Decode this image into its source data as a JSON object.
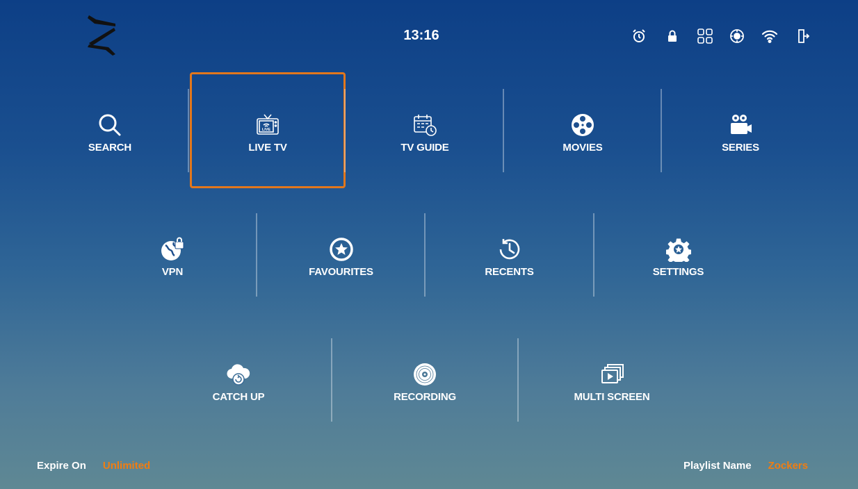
{
  "header": {
    "time": "13:16",
    "icons": [
      "alarm-icon",
      "lock-icon",
      "grid-icon",
      "sync-settings-icon",
      "wifi-icon",
      "exit-icon"
    ]
  },
  "menu": {
    "row1": [
      {
        "label": "SEARCH",
        "icon": "search-icon"
      },
      {
        "label": "LIVE TV",
        "icon": "tv-icon",
        "selected": true
      },
      {
        "label": "TV GUIDE",
        "icon": "calendar-clock-icon"
      },
      {
        "label": "MOVIES",
        "icon": "film-reel-icon"
      },
      {
        "label": "SERIES",
        "icon": "video-camera-icon"
      }
    ],
    "row2": [
      {
        "label": "VPN",
        "icon": "vpn-globe-icon"
      },
      {
        "label": "FAVOURITES",
        "icon": "star-icon"
      },
      {
        "label": "RECENTS",
        "icon": "history-icon"
      },
      {
        "label": "SETTINGS",
        "icon": "gear-icon"
      }
    ],
    "row3": [
      {
        "label": "CATCH UP",
        "icon": "cloud-replay-icon"
      },
      {
        "label": "RECORDING",
        "icon": "disc-icon"
      },
      {
        "label": "MULTI SCREEN",
        "icon": "multi-screen-icon"
      }
    ]
  },
  "footer": {
    "expire_label": "Expire On",
    "expire_value": "Unlimited",
    "playlist_label": "Playlist Name",
    "playlist_value": "Zockers"
  },
  "colors": {
    "accent": "#f07d12",
    "selection_border": "#e2771c"
  }
}
